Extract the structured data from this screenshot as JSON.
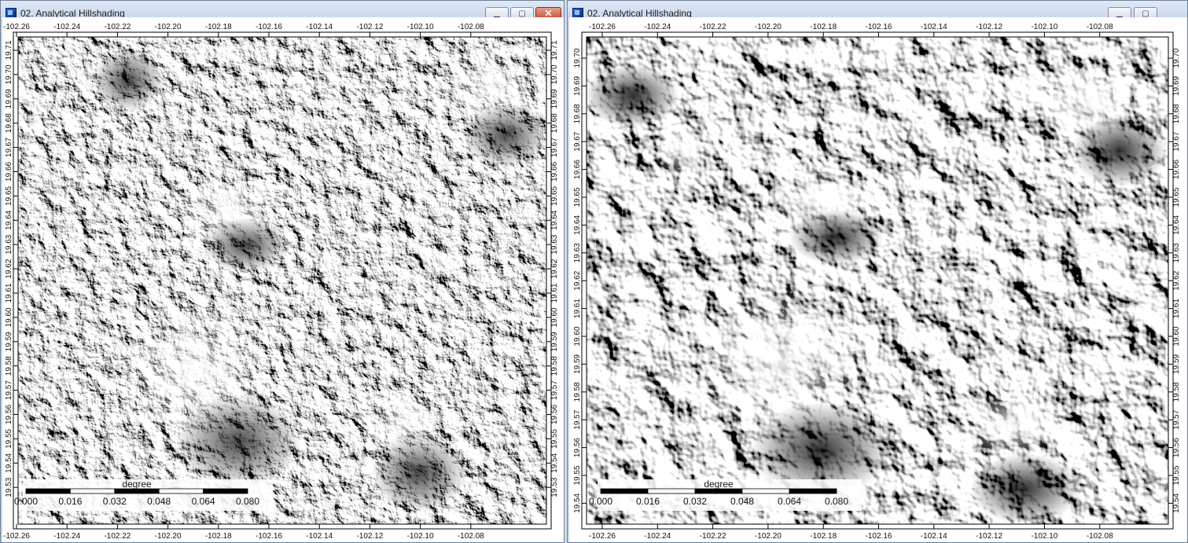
{
  "windows": [
    {
      "title": "02. Analytical Hillshading",
      "buttons": {
        "minimize": "▁",
        "maximize": "▢",
        "close": "✕"
      },
      "x_ticks": [
        "-102.26",
        "-102.24",
        "-102.22",
        "-102.20",
        "-102.18",
        "-102.16",
        "-102.14",
        "-102.12",
        "-102.10",
        "-102.08"
      ],
      "y_ticks": [
        "19.71",
        "19.70",
        "19.69",
        "19.68",
        "19.67",
        "19.66",
        "19.65",
        "19.64",
        "19.63",
        "19.62",
        "19.61",
        "19.60",
        "19.59",
        "19.58",
        "19.57",
        "19.56",
        "19.55",
        "19.54",
        "19.53"
      ],
      "legend": {
        "title": "degree",
        "labels": [
          "0.000",
          "0.016",
          "0.032",
          "0.048",
          "0.064",
          "0.080"
        ]
      }
    },
    {
      "title": "02. Analytical Hillshading",
      "buttons": {
        "minimize": "▁",
        "maximize": "▢"
      },
      "x_ticks": [
        "-102.26",
        "-102.24",
        "-102.22",
        "-102.20",
        "-102.18",
        "-102.16",
        "-102.14",
        "-102.12",
        "-102.10",
        "-102.08"
      ],
      "y_ticks": [
        "19.70",
        "19.69",
        "19.68",
        "19.67",
        "19.66",
        "19.65",
        "19.64",
        "19.63",
        "19.62",
        "19.61",
        "19.60",
        "19.59",
        "19.58",
        "19.57",
        "19.56",
        "19.55",
        "19.54"
      ],
      "legend": {
        "title": "degree",
        "labels": [
          "0.000",
          "0.016",
          "0.032",
          "0.048",
          "0.064",
          "0.080"
        ]
      }
    }
  ],
  "colors": {
    "map_dark": "#2a2a2a",
    "map_light": "#f4f4f4",
    "frame": "#000000",
    "titlebar": "#c3d3e8"
  }
}
